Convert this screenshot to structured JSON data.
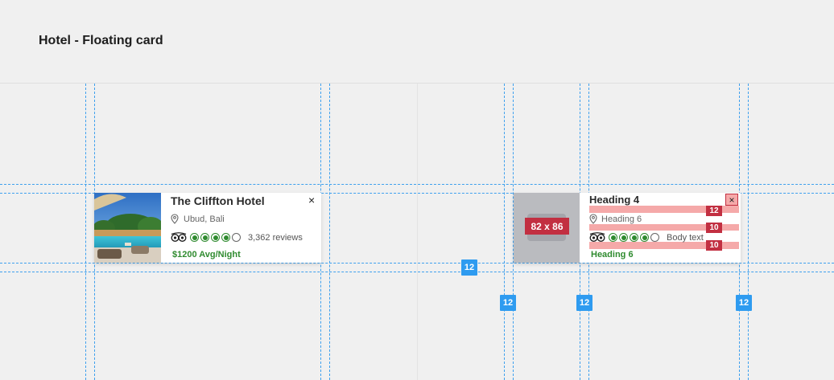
{
  "page": {
    "title": "Hotel - Floating card"
  },
  "hotel_card": {
    "name": "The Cliffton Hotel",
    "location": "Ubud, Bali",
    "rating_bubbles": 4,
    "rating_max": 5,
    "reviews": "3,362 reviews",
    "price": "$1200 Avg/Night",
    "close_symbol": "×",
    "icons": {
      "location": "location-pin-icon",
      "tripadvisor": "tripadvisor-owl-icon",
      "close": "close-icon"
    }
  },
  "spec_card": {
    "image_size_label": "82 x 86",
    "heading": "Heading 4",
    "location": "Heading 6",
    "rating_bubbles": 4,
    "body_text": "Body text",
    "footer": "Heading 6",
    "close_symbol": "×",
    "spacing_labels": [
      "12",
      "10",
      "10"
    ]
  },
  "spacing_badges": [
    "12",
    "12",
    "12",
    "12"
  ],
  "colors": {
    "guide": "#3ea0ee",
    "badge": "#2e9bf0",
    "spec_red": "#c22f41",
    "spec_pink": "#f5a9a9",
    "rating_green": "#2f8b2f"
  }
}
